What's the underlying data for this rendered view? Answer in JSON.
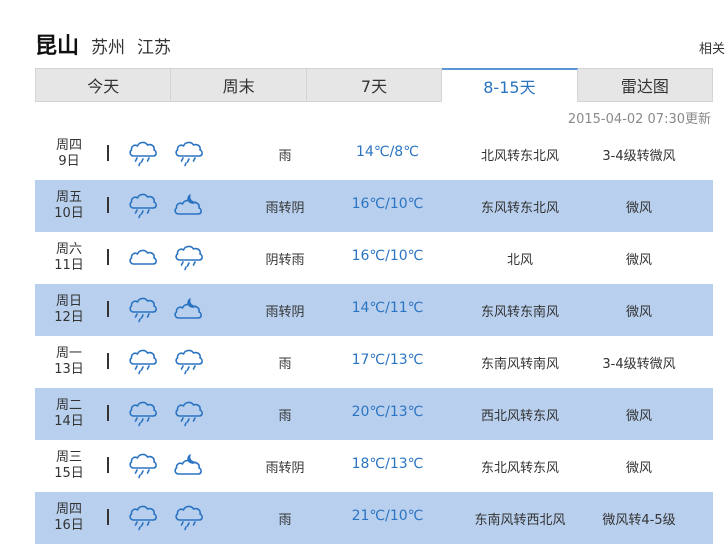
{
  "header": {
    "city": "昆山",
    "parent": "苏州",
    "province": "江苏",
    "related": "相关"
  },
  "tabs": [
    {
      "label": "今天",
      "active": false
    },
    {
      "label": "周末",
      "active": false
    },
    {
      "label": "7天",
      "active": false
    },
    {
      "label": "8-15天",
      "active": true
    },
    {
      "label": "雷达图",
      "active": false
    }
  ],
  "updated": "2015-04-02 07:30更新",
  "colors": {
    "accent": "#2b74c2",
    "row_alt": "#b8cfee",
    "tab_bg": "#e6e6e6"
  },
  "forecast": [
    {
      "weekday": "周四",
      "date": "9日",
      "icon_day": "rain-cloud-icon",
      "icon_night": "rain-cloud-icon",
      "condition": "雨",
      "temp": "14℃/8℃",
      "wind": "北风转东北风",
      "force": "3-4级转微风"
    },
    {
      "weekday": "周五",
      "date": "10日",
      "icon_day": "rain-cloud-icon",
      "icon_night": "cloudy-night-icon",
      "condition": "雨转阴",
      "temp": "16℃/10℃",
      "wind": "东风转东北风",
      "force": "微风"
    },
    {
      "weekday": "周六",
      "date": "11日",
      "icon_day": "cloud-icon",
      "icon_night": "rain-cloud-icon",
      "condition": "阴转雨",
      "temp": "16℃/10℃",
      "wind": "北风",
      "force": "微风"
    },
    {
      "weekday": "周日",
      "date": "12日",
      "icon_day": "rain-cloud-icon",
      "icon_night": "cloudy-night-icon",
      "condition": "雨转阴",
      "temp": "14℃/11℃",
      "wind": "东风转东南风",
      "force": "微风"
    },
    {
      "weekday": "周一",
      "date": "13日",
      "icon_day": "rain-cloud-icon",
      "icon_night": "rain-cloud-icon",
      "condition": "雨",
      "temp": "17℃/13℃",
      "wind": "东南风转南风",
      "force": "3-4级转微风"
    },
    {
      "weekday": "周二",
      "date": "14日",
      "icon_day": "rain-cloud-icon",
      "icon_night": "rain-cloud-icon",
      "condition": "雨",
      "temp": "20℃/13℃",
      "wind": "西北风转东风",
      "force": "微风"
    },
    {
      "weekday": "周三",
      "date": "15日",
      "icon_day": "rain-cloud-icon",
      "icon_night": "cloudy-night-icon",
      "condition": "雨转阴",
      "temp": "18℃/13℃",
      "wind": "东北风转东风",
      "force": "微风"
    },
    {
      "weekday": "周四",
      "date": "16日",
      "icon_day": "rain-cloud-icon",
      "icon_night": "rain-cloud-icon",
      "condition": "雨",
      "temp": "21℃/10℃",
      "wind": "东南风转西北风",
      "force": "微风转4-5级"
    }
  ]
}
